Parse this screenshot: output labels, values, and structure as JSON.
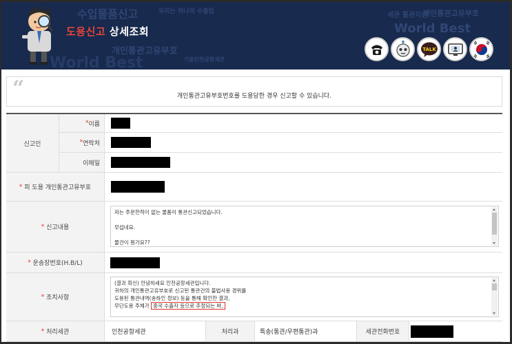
{
  "header": {
    "title_accent": "도용신고",
    "title_rest": " 상세조회",
    "watermarks": [
      "수입물품신고",
      "우리는 하나의 수출입",
      "개인통관고유부호",
      "World Best",
      "기술인천공항세관",
      "World Best",
      "세관 통관지원",
      "개인통관고유부호"
    ],
    "icons": [
      {
        "name": "phone-icon",
        "color": "#1a1a1a"
      },
      {
        "name": "chatbot-icon",
        "color": "#555555"
      },
      {
        "name": "kakaotalk-icon",
        "label": "TALK",
        "color": "#f5d31c"
      },
      {
        "name": "monitor-icon",
        "color": "#333333"
      },
      {
        "name": "korea-emblem-icon",
        "color": "#c8102e"
      }
    ]
  },
  "notice": {
    "text": "개인통관고유부호번호를 도용당한 경우 신고할 수 있습니다."
  },
  "form": {
    "reporter_group_label": "신고인",
    "name_label": "이름",
    "contact_label": "연락처",
    "email_label": "이메일",
    "victim_code_label": "피 도용 개인통관고유부호",
    "content_label": "신고내용",
    "content_lines": [
      "저는 주문한적이 없는 물품이 통관신고되었습니다.",
      "",
      "무섭네요.",
      "",
      "물건이 뭔가요??"
    ],
    "waybill_label": "운송장번호(H.B/L)",
    "action_label": "조치사항",
    "action_lines": [
      "(결과 회신) 안녕하세요 인천공항세관입니다.",
      "귀하의 개인통관고유부호로 신고된 통관건의 불법사용 경위를",
      "도용된 통관내역(송하인 정보) 등을 통해 확인한 결과,"
    ],
    "action_line_prefix": "무단도용 주체가 ",
    "action_highlight": "중국 수출자 등으로 추정되는 바,",
    "office_label": "처리세관",
    "office_value": "인천공항세관",
    "dept_label": "처리과",
    "dept_value": "특송(통관/우편통관)과",
    "phone_label": "세관전화번호",
    "required_mark": "*"
  }
}
